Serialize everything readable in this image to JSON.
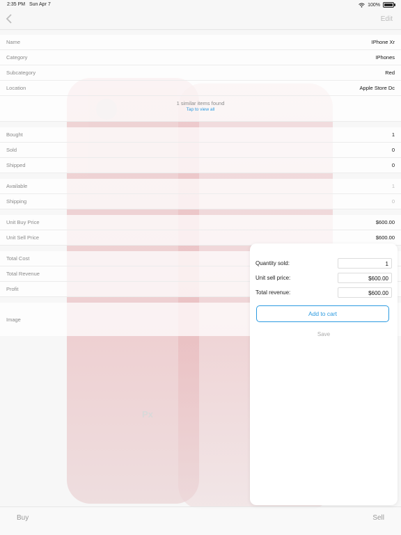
{
  "status": {
    "time": "2:35 PM",
    "date": "Sun Apr 7",
    "battery": "100%"
  },
  "nav": {
    "edit_label": "Edit"
  },
  "details": {
    "name_label": "Name",
    "name_value": "IPhone Xr",
    "category_label": "Category",
    "category_value": "IPhones",
    "subcategory_label": "Subcategory",
    "subcategory_value": "Red",
    "location_label": "Location",
    "location_value": "Apple Store Dc"
  },
  "similar": {
    "text": "1 similar items found",
    "link": "Tap to view all"
  },
  "stock": {
    "bought_label": "Bought",
    "bought_value": "1",
    "sold_label": "Sold",
    "sold_value": "0",
    "shipped_label": "Shipped",
    "shipped_value": "0"
  },
  "availability": {
    "available_label": "Available",
    "available_value": "1",
    "shipping_label": "Shipping",
    "shipping_value": "0"
  },
  "prices": {
    "buy_label": "Unit Buy Price",
    "buy_value": "$600.00",
    "sell_label": "Unit Sell Price",
    "sell_value": "$600.00"
  },
  "totals": {
    "cost_label": "Total Cost",
    "revenue_label": "Total Revenue",
    "profit_label": "Profit"
  },
  "image": {
    "label": "Image",
    "logo_text": "Px"
  },
  "sell_form": {
    "quantity_label": "Quantity sold:",
    "quantity_value": "1",
    "unit_price_label": "Unit sell price:",
    "unit_price_value": "$600.00",
    "total_revenue_label": "Total revenue:",
    "total_revenue_value": "$600.00",
    "add_to_cart_label": "Add to cart",
    "save_label": "Save"
  },
  "tabs": {
    "buy_label": "Buy",
    "sell_label": "Sell"
  },
  "colors": {
    "accent": "#2b9ae0",
    "muted": "#8a8a8a"
  }
}
